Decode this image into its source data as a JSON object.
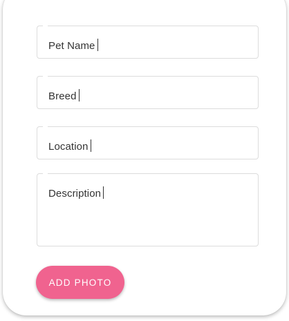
{
  "form": {
    "fields": {
      "pet_name": {
        "placeholder": "Pet Name",
        "value": ""
      },
      "breed": {
        "placeholder": "Breed",
        "value": ""
      },
      "location": {
        "placeholder": "Location",
        "value": ""
      },
      "description": {
        "placeholder": "Description",
        "value": ""
      }
    },
    "add_photo_label": "ADD PHOTO"
  },
  "colors": {
    "accent": "#f0638f",
    "field_border": "#dcdcdc",
    "text": "#333333"
  }
}
